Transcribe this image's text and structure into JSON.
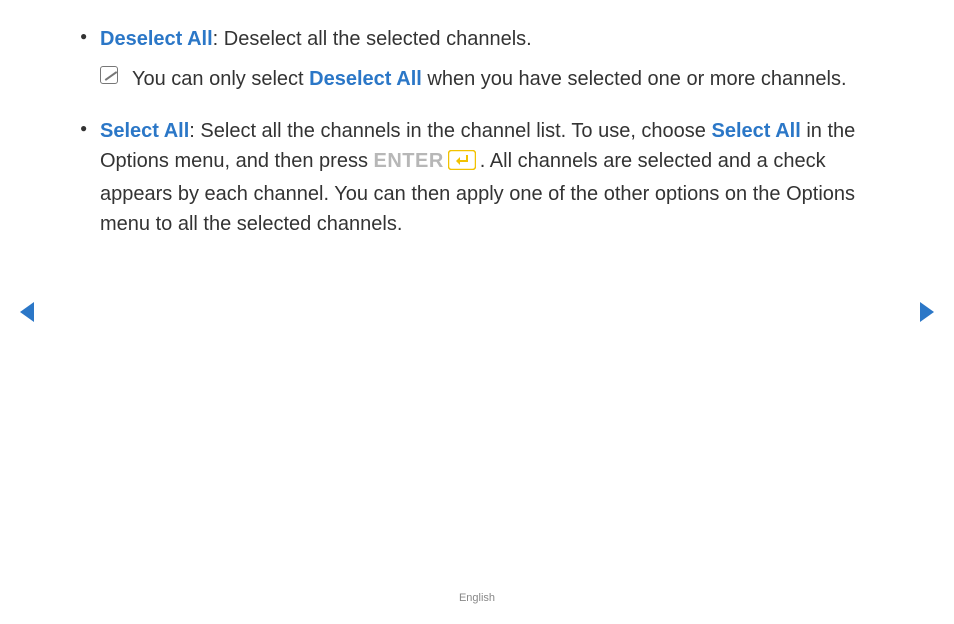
{
  "items": [
    {
      "title": "Deselect All",
      "desc_after_colon": ": Deselect all the selected channels.",
      "note_before": "You can only select ",
      "note_bold": "Deselect All",
      "note_after": " when you have selected one or more channels."
    },
    {
      "title": "Select All",
      "seg1": ": Select all the channels in the channel list. To use, choose ",
      "seg1_bold": "Select All",
      "seg2": " in the Options menu, and then press ",
      "enter_label": "ENTER",
      "seg3": ". All channels are selected and a check appears by each channel. You can then apply one of the other options on the Options menu to all the selected channels."
    }
  ],
  "footer": "English"
}
